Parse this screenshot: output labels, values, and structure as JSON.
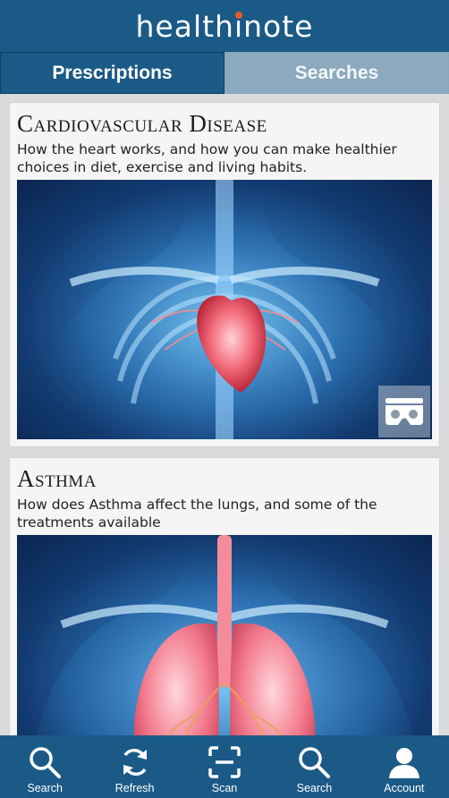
{
  "app": {
    "logo_text_before": "health",
    "logo_text_i": "i",
    "logo_text_after": "note"
  },
  "tabs": [
    {
      "label": "Prescriptions",
      "active": true
    },
    {
      "label": "Searches",
      "active": false
    }
  ],
  "cards": [
    {
      "title": "Cardiovascular Disease",
      "description": "How the heart works, and how you can make healthier choices in diet, exercise and living habits.",
      "image": "heart-xray-image",
      "vr_badge": "vr-headset-icon"
    },
    {
      "title": "Asthma",
      "description": "How does Asthma affect the lungs, and some of the treatments available",
      "image": "lungs-xray-image"
    }
  ],
  "navbar": {
    "items": [
      {
        "label": "Search",
        "icon": "search-icon"
      },
      {
        "label": "Refresh",
        "icon": "refresh-icon"
      },
      {
        "label": "Scan",
        "icon": "scan-icon"
      },
      {
        "label": "Search",
        "icon": "search-icon"
      },
      {
        "label": "Account",
        "icon": "account-icon"
      }
    ]
  },
  "colors": {
    "brand": "#1b5a87",
    "inactive_tab": "#8da9bf",
    "logo_dot": "#e65a2b"
  }
}
